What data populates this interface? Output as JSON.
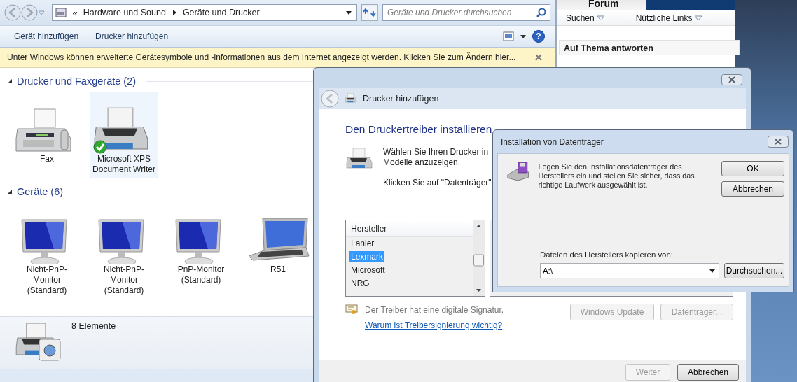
{
  "explorer": {
    "overflow": "«",
    "breadcrumb": [
      "Hardware und Sound",
      "Geräte und Drucker"
    ],
    "help": "?",
    "search": {
      "placeholder": "Geräte und Drucker durchsuchen"
    },
    "toolbar": [
      "Gerät hinzufügen",
      "Drucker hinzufügen"
    ],
    "infobar": "Unter Windows können erweiterte Gerätesymbole und -informationen aus dem Internet angezeigt werden. Klicken Sie zum Ändern hier...",
    "groups": [
      {
        "title": "Drucker und Faxgeräte (2)",
        "expanded": true,
        "items": [
          {
            "label": "Fax",
            "kind": "fax",
            "selected": false,
            "default": false
          },
          {
            "label": "Microsoft XPS Document Writer",
            "kind": "printer",
            "selected": true,
            "default": true
          }
        ]
      },
      {
        "title": "Geräte (6)",
        "expanded": true,
        "items": [
          {
            "label": "Nicht-PnP-Monitor (Standard)",
            "kind": "monitor",
            "selected": false,
            "default": false
          },
          {
            "label": "Nicht-PnP-Monitor (Standard)",
            "kind": "monitor",
            "selected": false,
            "default": false
          },
          {
            "label": "PnP-Monitor (Standard)",
            "kind": "monitor",
            "selected": false,
            "default": false
          },
          {
            "label": "R51",
            "kind": "laptop",
            "selected": false,
            "default": false
          }
        ]
      }
    ],
    "details": "8 Elemente"
  },
  "forum": {
    "tab": "Forum",
    "menu": [
      "Suchen",
      "Nützliche Links"
    ],
    "heading": "Auf Thema antworten"
  },
  "wizard": {
    "title": "Drucker hinzufügen",
    "heading": "Den Druckertreiber installieren",
    "paragraphs": [
      [
        "Wählen Sie Ihren Drucker in",
        "Modelle anzuzeigen."
      ],
      [
        "Klicken Sie auf \"Datenträger\","
      ]
    ],
    "list": {
      "header": "Hersteller",
      "items": [
        {
          "label": "Lanier",
          "selected": false
        },
        {
          "label": "Lexmark",
          "selected": true
        },
        {
          "label": "Microsoft",
          "selected": false
        },
        {
          "label": "NRG",
          "selected": false
        }
      ]
    },
    "signature": "Der Treiber hat eine digitale Signatur.",
    "link": "Warum ist Treibersignierung wichtig?",
    "buttons": [
      {
        "label": "Windows Update",
        "disabled": true
      },
      {
        "label": "Datenträger...",
        "disabled": true
      }
    ],
    "footer_buttons": [
      {
        "label": "Weiter",
        "disabled": true
      },
      {
        "label": "Abbrechen",
        "disabled": false
      }
    ]
  },
  "disk_dialog": {
    "title": "Installation von Datenträger",
    "message": "Legen Sie den Installationsdatenträger des Herstellers ein und stellen Sie sicher, dass das richtige Laufwerk ausgewählt ist.",
    "buttons": [
      "OK",
      "Abbrechen"
    ],
    "copy_label": "Dateien des Herstellers kopieren von:",
    "path": {
      "value": "A:\\"
    },
    "browse": "Durchsuchen..."
  }
}
